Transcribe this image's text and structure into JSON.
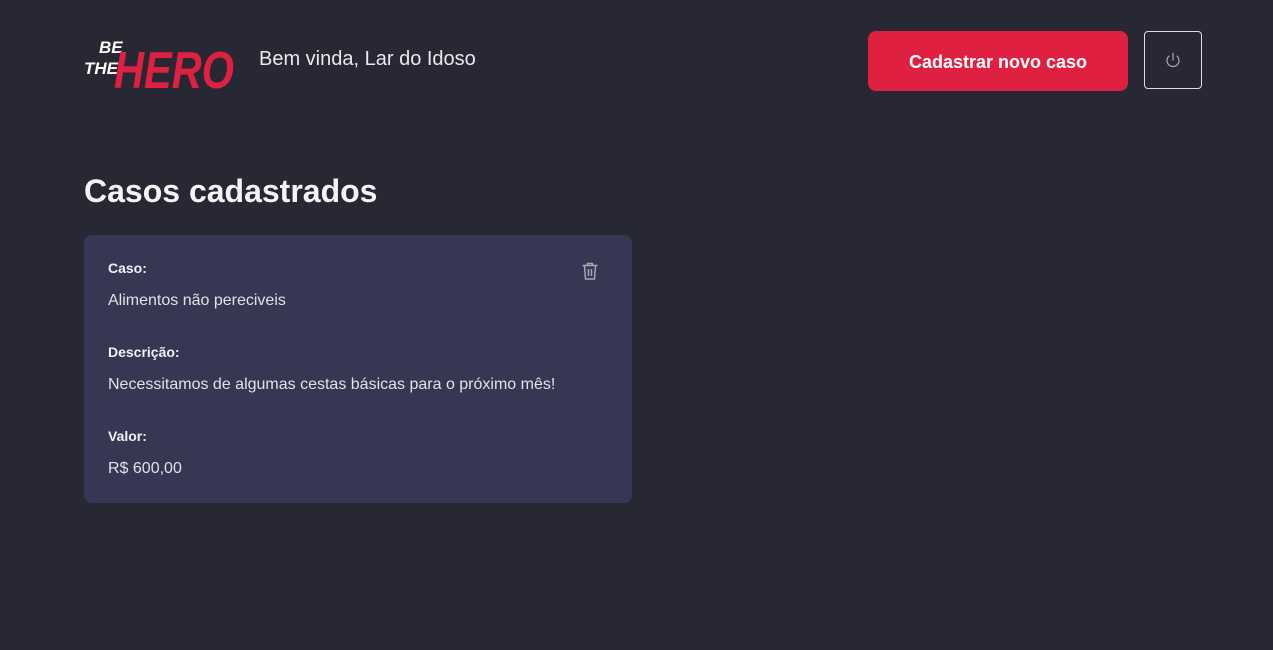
{
  "header": {
    "logo": {
      "text_line1": "BE",
      "text_line2": "THE",
      "text_big": "HERO",
      "icon": "be-the-hero-logo"
    },
    "greeting": "Bem vinda, Lar do Idoso",
    "new_case_button_label": "Cadastrar novo caso",
    "logout_icon": "power-icon"
  },
  "main": {
    "title": "Casos cadastrados",
    "cases": [
      {
        "case_label": "Caso:",
        "case_value": "Alimentos não pereciveis",
        "description_label": "Descrição:",
        "description_value": "Necessitamos de algumas cestas básicas para o próximo mês!",
        "value_label": "Valor:",
        "value_value": "R$ 600,00",
        "delete_icon": "trash-icon"
      }
    ]
  },
  "colors": {
    "background": "#272833",
    "card": "#363853",
    "accent": "#e02041",
    "text": "#ffffff"
  }
}
